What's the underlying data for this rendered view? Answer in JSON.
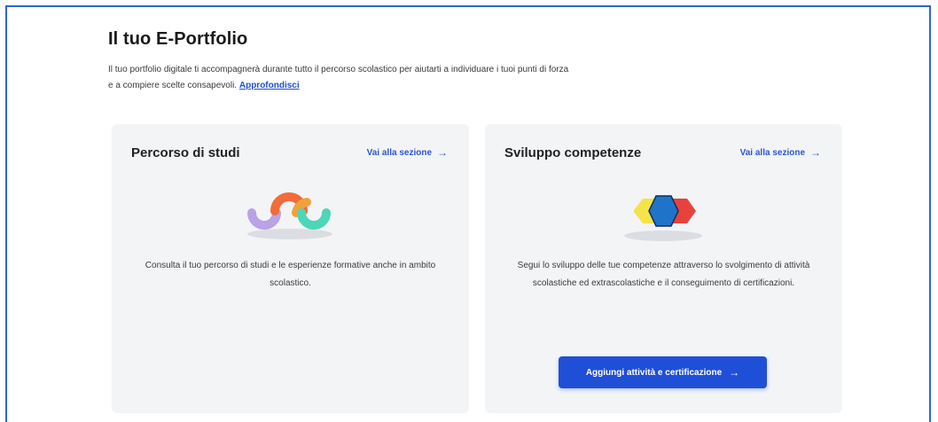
{
  "header": {
    "title": "Il tuo E-Portfolio",
    "intro": "Il tuo portfolio digitale ti accompagnerà durante tutto il percorso scolastico per aiutarti a individuare i tuoi punti di forza e a compiere scelte consapevoli.",
    "intro_link": "Approfondisci"
  },
  "cards": [
    {
      "title": "Percorso di studi",
      "link": "Vai alla sezione",
      "description": "Consulta il tuo percorso di studi e le esperienze formative anche in ambito scolastico.",
      "illustration_icon": "wave-arcs-icon"
    },
    {
      "title": "Sviluppo competenze",
      "link": "Vai alla sezione",
      "description": "Segui lo sviluppo delle tue competenze attraverso lo svolgimento di attività scolastiche ed extrascolastiche e il conseguimento di certificazioni.",
      "button": "Aggiungi attività e certificazione",
      "illustration_icon": "hexagons-icon"
    }
  ],
  "colors": {
    "accent": "#1f4fd6",
    "card_bg": "#f3f4f6",
    "frame_border": "#2f64d6",
    "arc_purple": "#b9a2e6",
    "arc_orange": "#f26b3a",
    "arc_green": "#4dd6b8",
    "hex_blue": "#1f74c9",
    "hex_yellow": "#f5e34a",
    "hex_red": "#e8423c"
  }
}
